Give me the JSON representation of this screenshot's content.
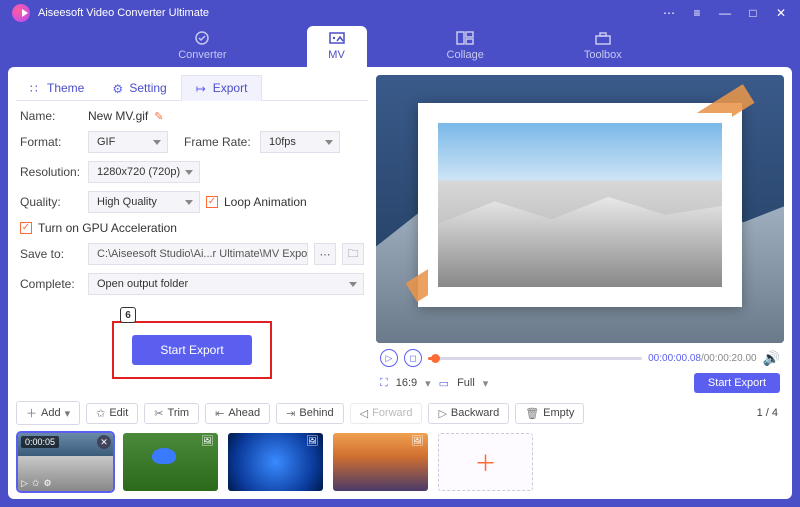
{
  "app": {
    "title": "Aiseesoft Video Converter Ultimate"
  },
  "nav": {
    "converter": "Converter",
    "mv": "MV",
    "collage": "Collage",
    "toolbox": "Toolbox"
  },
  "subtabs": {
    "theme": "Theme",
    "setting": "Setting",
    "export": "Export"
  },
  "form": {
    "name_label": "Name:",
    "name_value": "New MV.gif",
    "format_label": "Format:",
    "format_value": "GIF",
    "framerate_label": "Frame Rate:",
    "framerate_value": "10fps",
    "resolution_label": "Resolution:",
    "resolution_value": "1280x720 (720p)",
    "quality_label": "Quality:",
    "quality_value": "High Quality",
    "loop_label": "Loop Animation",
    "gpu_label": "Turn on GPU Acceleration",
    "saveto_label": "Save to:",
    "saveto_value": "C:\\Aiseesoft Studio\\Ai...r Ultimate\\MV Exported",
    "complete_label": "Complete:",
    "complete_value": "Open output folder"
  },
  "callout": {
    "num": "6"
  },
  "buttons": {
    "start_export": "Start Export",
    "start_export2": "Start Export"
  },
  "player": {
    "current": "00:00:00.08",
    "total": "00:00:20.00",
    "aspect": "16:9",
    "view": "Full"
  },
  "toolbar": {
    "add": "Add",
    "edit": "Edit",
    "trim": "Trim",
    "ahead": "Ahead",
    "behind": "Behind",
    "forward": "Forward",
    "backward": "Backward",
    "empty": "Empty"
  },
  "counter": {
    "cur": "1",
    "sep": " / ",
    "tot": "4"
  },
  "thumbs": {
    "t1_duration": "0:00:05"
  }
}
